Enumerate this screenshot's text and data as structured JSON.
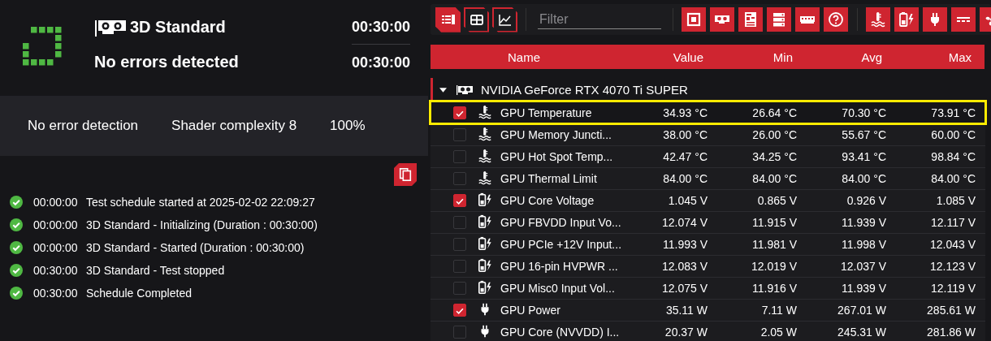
{
  "test": {
    "title": "3D Standard",
    "status": "No errors detected",
    "time_elapsed": "00:30:00",
    "time_total": "00:30:00"
  },
  "settings": [
    "No error detection",
    "Shader complexity 8",
    "100%"
  ],
  "log": [
    {
      "time": "00:00:00",
      "message": "Test schedule started at 2025-02-02 22:09:27"
    },
    {
      "time": "00:00:00",
      "message": "3D Standard - Initializing (Duration : 00:30:00)"
    },
    {
      "time": "00:00:00",
      "message": "3D Standard - Started (Duration : 00:30:00)"
    },
    {
      "time": "00:30:00",
      "message": "3D Standard - Test stopped"
    },
    {
      "time": "00:30:00",
      "message": "Schedule Completed"
    }
  ],
  "toolbar": {
    "view_buttons": [
      {
        "selected": true
      },
      {
        "selected": false
      },
      {
        "selected": false
      }
    ],
    "filter": {
      "placeholder": "Filter"
    }
  },
  "table": {
    "columns": [
      "Name",
      "Value",
      "Min",
      "Avg",
      "Max"
    ],
    "group": {
      "name": "NVIDIA GeForce RTX 4070 Ti SUPER",
      "expanded": true
    },
    "rows": [
      {
        "kind": "temperature",
        "checked": true,
        "highlighted": true,
        "name": "GPU Temperature",
        "value": "34.93 °C",
        "min": "26.64 °C",
        "avg": "70.30 °C",
        "max": "73.91 °C"
      },
      {
        "kind": "temperature",
        "checked": false,
        "highlighted": false,
        "name": "GPU Memory Juncti...",
        "value": "38.00 °C",
        "min": "26.00 °C",
        "avg": "55.67 °C",
        "max": "60.00 °C"
      },
      {
        "kind": "temperature",
        "checked": false,
        "highlighted": false,
        "name": "GPU Hot Spot Temp...",
        "value": "42.47 °C",
        "min": "34.25 °C",
        "avg": "93.41 °C",
        "max": "98.84 °C"
      },
      {
        "kind": "temperature",
        "checked": false,
        "highlighted": false,
        "name": "GPU Thermal Limit",
        "value": "84.00 °C",
        "min": "84.00 °C",
        "avg": "84.00 °C",
        "max": "84.00 °C"
      },
      {
        "kind": "voltage",
        "checked": true,
        "highlighted": false,
        "name": "GPU Core Voltage",
        "value": "1.045 V",
        "min": "0.865 V",
        "avg": "0.926 V",
        "max": "1.085 V"
      },
      {
        "kind": "voltage",
        "checked": false,
        "highlighted": false,
        "name": "GPU FBVDD Input Vo...",
        "value": "12.074 V",
        "min": "11.915 V",
        "avg": "11.939 V",
        "max": "12.117 V"
      },
      {
        "kind": "voltage",
        "checked": false,
        "highlighted": false,
        "name": "GPU PCIe +12V Input...",
        "value": "11.993 V",
        "min": "11.981 V",
        "avg": "11.998 V",
        "max": "12.043 V"
      },
      {
        "kind": "voltage",
        "checked": false,
        "highlighted": false,
        "name": "GPU 16-pin HVPWR ...",
        "value": "12.083 V",
        "min": "12.019 V",
        "avg": "12.037 V",
        "max": "12.123 V"
      },
      {
        "kind": "voltage",
        "checked": false,
        "highlighted": false,
        "name": "GPU Misc0 Input Vol...",
        "value": "12.075 V",
        "min": "11.916 V",
        "avg": "11.939 V",
        "max": "12.119 V"
      },
      {
        "kind": "power",
        "checked": true,
        "highlighted": false,
        "name": "GPU Power",
        "value": "35.11 W",
        "min": "7.11 W",
        "avg": "267.01 W",
        "max": "285.61 W"
      },
      {
        "kind": "power",
        "checked": false,
        "highlighted": false,
        "name": "GPU Core (NVVDD) I...",
        "value": "20.37 W",
        "min": "2.05 W",
        "avg": "245.31 W",
        "max": "281.86 W"
      }
    ]
  }
}
